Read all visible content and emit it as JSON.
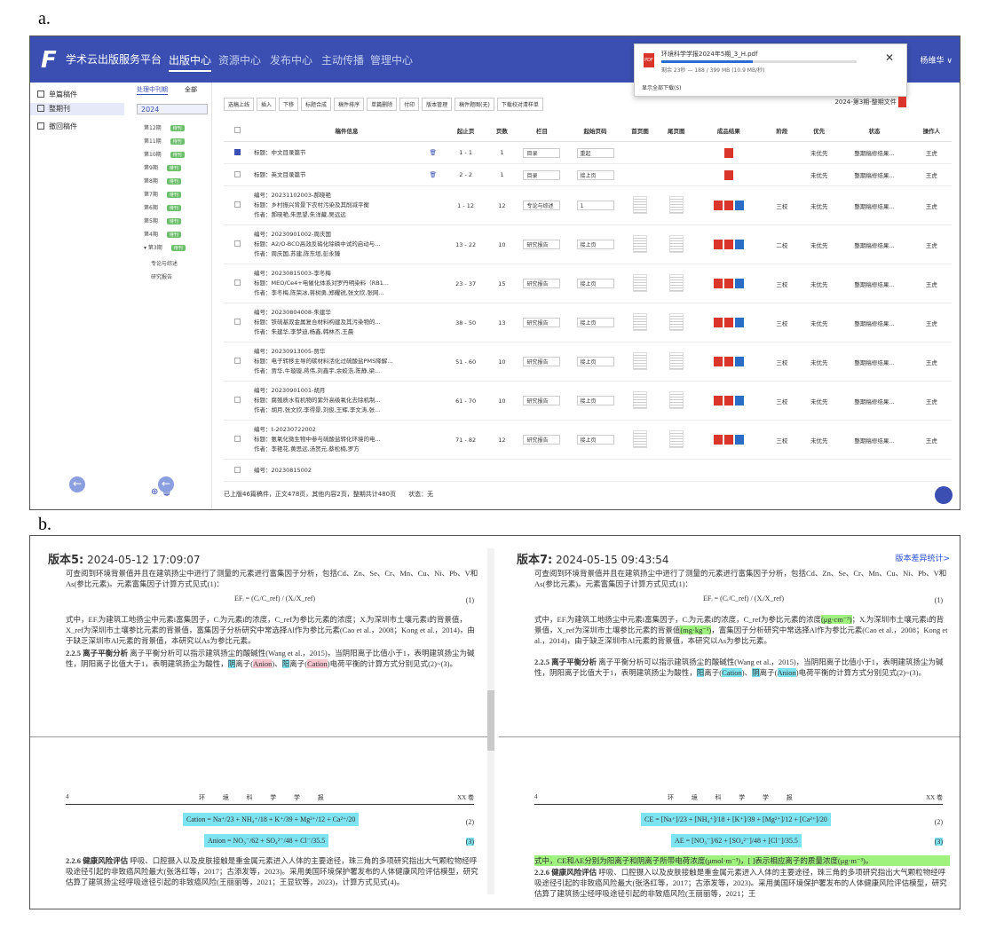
{
  "labels": {
    "a": "a.",
    "b": "b."
  },
  "panel_a": {
    "app_title": "学术云出版服务平台",
    "logo": "F",
    "nav": [
      "出版中心",
      "资源中心",
      "发布中心",
      "主动传播",
      "管理中心"
    ],
    "user": "杨维华 ∨",
    "download": {
      "file": "环境科学学报2024年5期_3_H.pdf",
      "status": "剩余 23秒 — 188 / 399 MB (10.9 MB/秒)",
      "progress": 0.47,
      "close": "✕",
      "show_all": "显示全部下载(S)"
    },
    "sidebar1": [
      "单篇稿件",
      "整期刊",
      "撤回稿件"
    ],
    "sidebar2": {
      "tabs": [
        "处理中刊期",
        "全部"
      ],
      "year": "2024",
      "issues": [
        {
          "name": "第12期",
          "badge": "待刊"
        },
        {
          "name": "第11期",
          "badge": "待刊"
        },
        {
          "name": "第10期",
          "badge": "待刊"
        },
        {
          "name": "第9期",
          "badge": "待刊"
        },
        {
          "name": "第8期",
          "badge": "待刊"
        },
        {
          "name": "第7期",
          "badge": "待刊"
        },
        {
          "name": "第6期",
          "badge": "待刊"
        },
        {
          "name": "第5期",
          "badge": "待刊"
        },
        {
          "name": "第4期",
          "badge": "待刊"
        },
        {
          "name": "▾ 第3期",
          "badge": "待刊"
        }
      ],
      "sub": [
        "专论与综述",
        "研究报告"
      ],
      "icons": "⊕ 🗑"
    },
    "toolbar": [
      "选稿上线",
      "插入",
      "下移",
      "标题合成",
      "稿件排序",
      "单篇删除",
      "付印",
      "版本管理",
      "稿件题图(无)",
      "下载校对清样单"
    ],
    "year_doc": "2024-第3期-整期文件",
    "columns": [
      "",
      "稿件信息",
      "起止页",
      "页数",
      "栏目",
      "起始页码",
      "首页图",
      "尾页图",
      "成品结果",
      "阶段",
      "优先",
      "状态",
      "操作人"
    ],
    "rows": [
      {
        "info": [
          "标题：中文目录篇节"
        ],
        "pages": "1 - 1",
        "count": "1",
        "column": "目录",
        "start": "重起",
        "thumbs": false,
        "files": [
          "pdf"
        ],
        "stage": "",
        "priority": "未优先",
        "status": "整期稿修结果...",
        "op": "王虎",
        "checked": true,
        "trash": true
      },
      {
        "info": [
          "标题：英文目录篇节"
        ],
        "pages": "2 - 2",
        "count": "1",
        "column": "目录",
        "start": "接上页",
        "thumbs": false,
        "files": [
          "pdf"
        ],
        "stage": "",
        "priority": "未优先",
        "status": "整期稿修结果...",
        "op": "王虎",
        "checked": false,
        "trash": true
      },
      {
        "info": [
          "编号：20231102003-郝晓艳",
          "标题：乡村振兴背景下农村污染及其削减平衡",
          "作者：郝晓艳,朱思望,朱洋藏,吴远远"
        ],
        "pages": "1 - 12",
        "count": "12",
        "column": "专论与综述",
        "start": "1",
        "thumbs": true,
        "files": [
          "pdf",
          "xml",
          "word"
        ],
        "stage": "三校",
        "priority": "未优先",
        "status": "整期稿修结果...",
        "op": "王虎",
        "checked": false,
        "trash": false
      },
      {
        "info": [
          "编号：20230901002-周庆国",
          "标题：A2/O-BCO高效反硝化除磷中试的启动与...",
          "作者：周庆国,苏建,陈东垣,彭永臻"
        ],
        "pages": "13 - 22",
        "count": "10",
        "column": "研究报告",
        "start": "接上页",
        "thumbs": true,
        "files": [
          "pdf",
          "xml",
          "word"
        ],
        "stage": "二校",
        "priority": "未优先",
        "status": "整期稿修结果...",
        "op": "王虎",
        "checked": false,
        "trash": false
      },
      {
        "info": [
          "编号：20230815003-李冬梅",
          "标题：MEO/Ce4+电催化体系对罗丹明染料（RB1...",
          "作者：李冬梅,陈荣冰,蒋树勇,郑耀锐,张文欣,张网..."
        ],
        "pages": "23 - 37",
        "count": "15",
        "column": "研究报告",
        "start": "接上页",
        "thumbs": true,
        "files": [
          "pdf",
          "xml",
          "word"
        ],
        "stage": "三校",
        "priority": "未优先",
        "status": "整期稿修结果...",
        "op": "王虎",
        "checked": false,
        "trash": false
      },
      {
        "info": [
          "编号：20230804008-朱建华",
          "标题：铁硫基双金属复合材料构建及其污染物的...",
          "作者：朱建华,李梦迪,杨鑫,韩林杰,王晨"
        ],
        "pages": "38 - 50",
        "count": "13",
        "column": "研究报告",
        "start": "接上页",
        "thumbs": true,
        "files": [
          "pdf",
          "xml",
          "word"
        ],
        "stage": "三校",
        "priority": "未优先",
        "status": "整期稿修结果...",
        "op": "王虎",
        "checked": false,
        "trash": false
      },
      {
        "info": [
          "编号：20230913005-贾华",
          "标题：电子转移主导的碳材料活化过硫酸盐PMS降解...",
          "作者：贾华,牛璇璇,蒋伟,刘鑫宇,余蛟浩,陈静,梁..."
        ],
        "pages": "51 - 60",
        "count": "10",
        "column": "研究报告",
        "start": "接上页",
        "thumbs": true,
        "files": [
          "pdf",
          "xml",
          "word"
        ],
        "stage": "三校",
        "priority": "未优先",
        "status": "整期稿修结果...",
        "op": "王虎",
        "checked": false,
        "trash": false
      },
      {
        "info": [
          "编号：20230901001-胡月",
          "标题：腐殖质水有机物的紫外高级氧化去除机制...",
          "作者：胡月,张文欣,李得景,刘俊,王辉,李文涛,张..."
        ],
        "pages": "61 - 70",
        "count": "10",
        "column": "研究报告",
        "start": "接上页",
        "thumbs": true,
        "files": [
          "pdf",
          "xml",
          "word"
        ],
        "stage": "三校",
        "priority": "未优先",
        "status": "整期稿修结果...",
        "op": "王虎",
        "checked": false,
        "trash": false
      },
      {
        "info": [
          "编号：t-20230722002",
          "标题：氨氧化微生物中参与硫酸盐转化环境的电...",
          "作者：李艳花,黄思远,汤贺元,蔡松楠,罗方"
        ],
        "pages": "71 - 82",
        "count": "12",
        "column": "研究报告",
        "start": "接上页",
        "thumbs": true,
        "files": [
          "pdf",
          "xml",
          "word"
        ],
        "stage": "三校",
        "priority": "未优先",
        "status": "整期稿修结果...",
        "op": "王虎",
        "checked": false,
        "trash": false
      },
      {
        "info": [
          "编号：20230815002"
        ],
        "pages": "",
        "count": "",
        "column": "",
        "start": "",
        "thumbs": false,
        "files": [],
        "stage": "",
        "priority": "",
        "status": "",
        "op": "",
        "checked": false,
        "trash": false
      }
    ],
    "footer": "已上版46篇稿件，正文478页，其他内容2页，整期共计480页　　状态：无"
  },
  "panel_b": {
    "left": {
      "version": "版本5:",
      "time": "2024-05-12 17:09:07",
      "para1": "可查阅到环境背景值并且在建筑扬尘中进行了测量的元素进行富集因子分析，包括Cd、Zn、Se、Cr、Mn、Cu、Ni、Pb、V和As(参比元素)。元素富集因子计算方式见式(1)：",
      "eq1": "EFᵢ = (Cᵢ/C_ref) / (Xᵢ/X_ref)",
      "eq1no": "(1)",
      "para2": "式中，EFᵢ为建筑工地扬尘中元素i富集因子，Cᵢ为元素i的浓度，C_ref为参比元素的浓度；Xᵢ为深圳市土壤元素i的背景值，X_ref为深圳市土壤参比元素的背景值，富集因子分析研究中常选择Al作为参比元素(Cao et al.，2008；Kong et al.，2014)，由于缺乏深圳市Al元素的背景值，本研究以As为参比元素。",
      "sec225": "2.2.5 离子平衡分析",
      "para3a": "离子平衡分析可以指示建筑扬尘的酸碱性(Wang et al.，2015)，当阴阳离子比值小于1，表明建筑扬尘为碱性，阴阳离子比值大于1，表明建筑扬尘为酸性，",
      "hl1": "阴",
      "t1": "离子(",
      "hl2": "Anion",
      "t2": ")、",
      "hl3": "阳",
      "t3": "离子(",
      "hl4": "Cation",
      "t4": ")电荷平衡的计算方式分别见式(2)~(3)。",
      "running": {
        "page": "4",
        "journal": "环 境 科 学 学 报",
        "vol": "XX 卷"
      },
      "eq2": "Cation = Na⁺/23 + NH₄⁺/18 + K⁺/39 + Mg²⁺/12 + Ca²⁺/20",
      "eq2no": "(2)",
      "eq3": "Anion = NO₃⁻/62 + SO₄²⁻/48 + Cl⁻/35.5",
      "eq3no": "(3)",
      "sec226": "2.2.6 健康风险评估",
      "para4": "呼吸、口腔摄入以及皮肤接触是重金属元素进入人体的主要途径，珠三角的多项研究指出大气颗粒物经呼吸途径引起的非致癌风险最大(张洛红等，2017；古添发等，2023)。采用美国环境保护署发布的人体健康风险评估模型，研究估算了建筑扬尘经呼吸途径引起的非致癌风险(王丽丽等，2021；王显钦等，2023)，计算方式见式(4)。"
    },
    "right": {
      "version": "版本7:",
      "time": "2024-05-15 09:43:54",
      "diff": "版本差异统计>",
      "para1": "可查阅到环境背景值并且在建筑扬尘中进行了测量的元素进行富集因子分析，包括Cd、Zn、Se、Cr、Mn、Cu、Ni、Pb、V和As(参比元素)。元素富集因子计算方式见式(1)：",
      "eq1": "EFᵢ = (Cᵢ/C_ref) / (Xᵢ/X_ref)",
      "eq1no": "(1)",
      "para2a": "式中，EFᵢ为建筑工地扬尘中元素i富集因子，Cᵢ为元素i的浓度，C_ref为参比元素的浓度",
      "hl_a": "(μg·cm⁻³)",
      "para2b": "；Xᵢ为深圳市土壤元素i的背景值，X_ref为深圳市土壤参比元素的背景值",
      "hl_b": "(mg·kg⁻¹)",
      "para2c": "，富集因子分析研究中常选择Al作为参比元素(Cao et al.，2008；Kong et al.，2014)，由于缺乏深圳市Al元素的背景值，本研究以As为参比元素。",
      "sec225": "2.2.5 离子平衡分析",
      "para3a": "离子平衡分析可以指示建筑扬尘的酸碱性(Wang et al.，2015)，当阴阳离子比值小于1，表明建筑扬尘为碱性，阴阳离子比值大于1，表明建筑扬尘为酸性，",
      "hl1": "阳",
      "t1": "离子(",
      "hl2": "Cation",
      "t2": ")、",
      "hl3": "阴",
      "t3": "离子(",
      "hl4": "Anion",
      "t4": ")电荷平衡的计算方式分别见式(2)~(3)。",
      "running": {
        "page": "4",
        "journal": "环 境 科 学 学 报",
        "vol": "XX 卷"
      },
      "eq2": "CE = [Na⁺]/23 + [NH₄⁺]/18 + [K⁺]/39 + [Mg²⁺]/12 + [Ca²⁺]/20",
      "eq2no": "(2)",
      "eq3": "AE = [NO₃⁻]/62 + [SO₄²⁻]/48 + [Cl⁻]/35.5",
      "eq3no": "(3)",
      "green": "式中，CE和AE分别为阳离子和阴离子所带电荷浓度(μmol·m⁻³)，[ ]表示相应离子的质量浓度(μg·m⁻³)。",
      "sec226": "2.2.6 健康风险评估",
      "para4": "呼吸、口腔摄入以及皮肤接触是重金属元素进入人体的主要途径，珠三角的多项研究指出大气颗粒物经呼吸途径引起的非致癌风险最大(张洛红等，2017；古添发等，2023)。采用美国环境保护署发布的人体健康风险评估模型，研究估算了建筑扬尘经呼吸途径引起的非致癌风险(王丽丽等，2021；王"
    }
  }
}
